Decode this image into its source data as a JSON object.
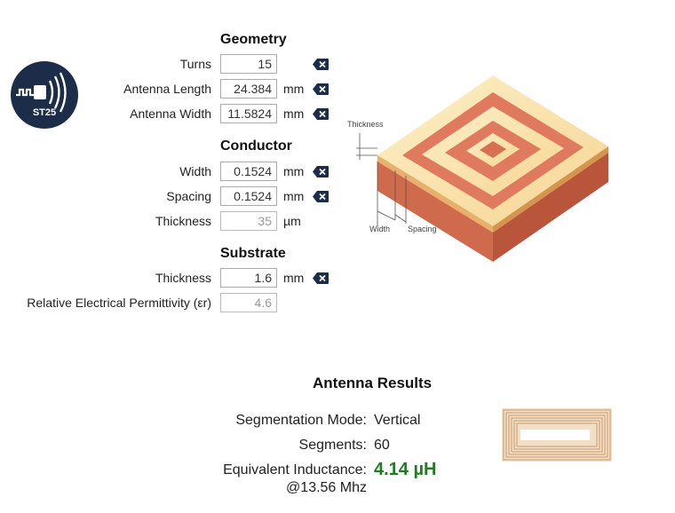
{
  "geometry": {
    "title": "Geometry",
    "turns": {
      "label": "Turns",
      "value": "15"
    },
    "length": {
      "label": "Antenna Length",
      "value": "24.384",
      "unit": "mm"
    },
    "width": {
      "label": "Antenna Width",
      "value": "11.5824",
      "unit": "mm"
    }
  },
  "conductor": {
    "title": "Conductor",
    "width": {
      "label": "Width",
      "value": "0.1524",
      "unit": "mm"
    },
    "spacing": {
      "label": "Spacing",
      "value": "0.1524",
      "unit": "mm"
    },
    "thickness": {
      "label": "Thickness",
      "value": "35",
      "unit": "µm"
    }
  },
  "substrate": {
    "title": "Substrate",
    "thickness": {
      "label": "Thickness",
      "value": "1.6",
      "unit": "mm"
    },
    "permittivity": {
      "label": "Relative Electrical Permittivity (εr)",
      "value": "4.6"
    }
  },
  "logo": {
    "text": "ST25"
  },
  "diagram": {
    "thickness_label": "Thickness",
    "width_label": "Width",
    "spacing_label": "Spacing"
  },
  "results": {
    "title": "Antenna Results",
    "segmentation_label": "Segmentation Mode:",
    "segmentation_value": "Vertical",
    "segments_label": "Segments:",
    "segments_value": "60",
    "inductance_label": "Equivalent Inductance:",
    "inductance_value": "4.14 µH",
    "frequency_label": "@13.56 Mhz"
  },
  "colors": {
    "accent_green": "#1e7e1e",
    "logo_navy": "#1c2d4a",
    "copper": "#d9745a",
    "cream": "#fbe2a8"
  }
}
